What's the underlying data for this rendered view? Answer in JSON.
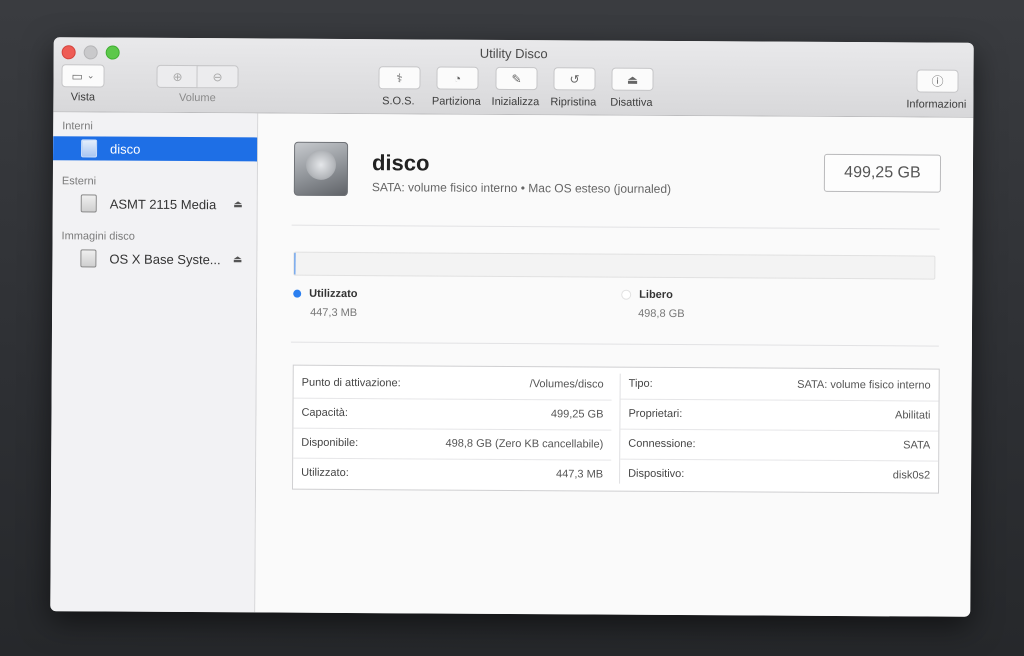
{
  "window": {
    "title": "Utility Disco"
  },
  "toolbar": {
    "vista_label": "Vista",
    "volume_label": "Volume",
    "sos_label": "S.O.S.",
    "partiziona_label": "Partiziona",
    "inizializza_label": "Inizializza",
    "ripristina_label": "Ripristina",
    "disattiva_label": "Disattiva",
    "informazioni_label": "Informazioni"
  },
  "sidebar": {
    "sections": [
      {
        "title": "Interni",
        "items": [
          {
            "label": "disco",
            "selected": true
          }
        ]
      },
      {
        "title": "Esterni",
        "items": [
          {
            "label": "ASMT 2115 Media",
            "eject": true
          }
        ]
      },
      {
        "title": "Immagini disco",
        "items": [
          {
            "label": "OS X Base Syste...",
            "eject": true
          }
        ]
      }
    ]
  },
  "disk": {
    "name": "disco",
    "description": "SATA: volume fisico interno • Mac OS esteso (journaled)",
    "size": "499,25 GB"
  },
  "usage": {
    "used_fraction": 0.0009,
    "used_label": "Utilizzato",
    "used_value": "447,3 MB",
    "used_color": "#2b7ff0",
    "free_label": "Libero",
    "free_value": "498,8 GB",
    "free_color": "#ffffff"
  },
  "info": {
    "left": [
      {
        "key": "Punto di attivazione:",
        "value": "/Volumes/disco"
      },
      {
        "key": "Capacità:",
        "value": "499,25 GB"
      },
      {
        "key": "Disponibile:",
        "value": "498,8 GB (Zero KB cancellabile)"
      },
      {
        "key": "Utilizzato:",
        "value": "447,3 MB"
      }
    ],
    "right": [
      {
        "key": "Tipo:",
        "value": "SATA: volume fisico interno"
      },
      {
        "key": "Proprietari:",
        "value": "Abilitati"
      },
      {
        "key": "Connessione:",
        "value": "SATA"
      },
      {
        "key": "Dispositivo:",
        "value": "disk0s2"
      }
    ]
  }
}
